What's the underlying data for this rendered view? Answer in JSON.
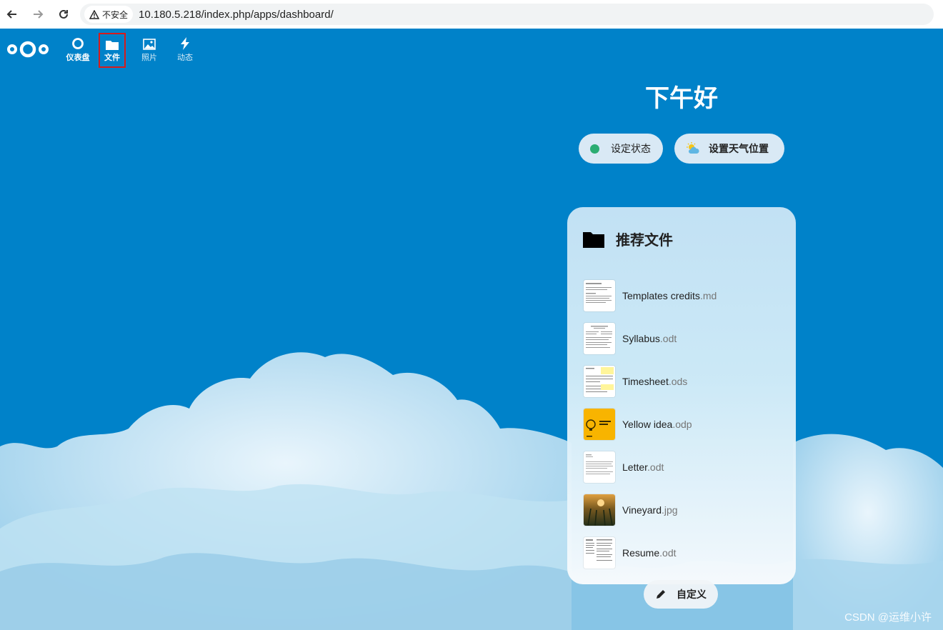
{
  "browser": {
    "security_label": "不安全",
    "url": "10.180.5.218/index.php/apps/dashboard/"
  },
  "apps": [
    {
      "label": "仪表盘",
      "icon": "dashboard-icon"
    },
    {
      "label": "文件",
      "icon": "folder-icon"
    },
    {
      "label": "照片",
      "icon": "image-icon"
    },
    {
      "label": "动态",
      "icon": "lightning-icon"
    }
  ],
  "dashboard": {
    "greeting": "下午好",
    "status_button": "设定状态",
    "weather_button": "设置天气位置",
    "panel_title": "推荐文件",
    "files": [
      {
        "name": "Templates credits",
        "ext": ".md"
      },
      {
        "name": "Syllabus",
        "ext": ".odt"
      },
      {
        "name": "Timesheet",
        "ext": ".ods"
      },
      {
        "name": "Yellow idea",
        "ext": ".odp"
      },
      {
        "name": "Letter",
        "ext": ".odt"
      },
      {
        "name": "Vineyard",
        "ext": ".jpg"
      },
      {
        "name": "Resume",
        "ext": ".odt"
      }
    ],
    "customize_button": "自定义"
  },
  "watermark": "CSDN @运维小许",
  "colors": {
    "brand_blue": "#0082c9",
    "status_green": "#2bad72",
    "highlight_red": "#d81b1b"
  }
}
